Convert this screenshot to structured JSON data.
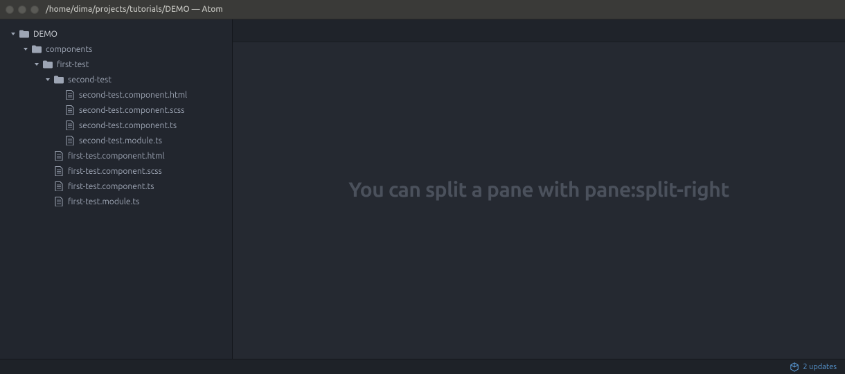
{
  "window": {
    "title": "/home/dima/projects/tutorials/DEMO — Atom"
  },
  "tree": {
    "root": "DEMO",
    "folder_components": "components",
    "folder_first_test": "first-test",
    "folder_second_test": "second-test",
    "files": {
      "second_html": "second-test.component.html",
      "second_scss": "second-test.component.scss",
      "second_ts": "second-test.component.ts",
      "second_module": "second-test.module.ts",
      "first_html": "first-test.component.html",
      "first_scss": "first-test.component.scss",
      "first_ts": "first-test.component.ts",
      "first_module": "first-test.module.ts"
    }
  },
  "editor": {
    "hint": "You can split a pane with pane:split-right"
  },
  "statusbar": {
    "updates_label": "2 updates"
  },
  "colors": {
    "accent_blue": "#5796d1",
    "sidebar_bg": "#22262e",
    "editor_bg": "#252931",
    "titlebar_bg": "#3a3a38"
  }
}
